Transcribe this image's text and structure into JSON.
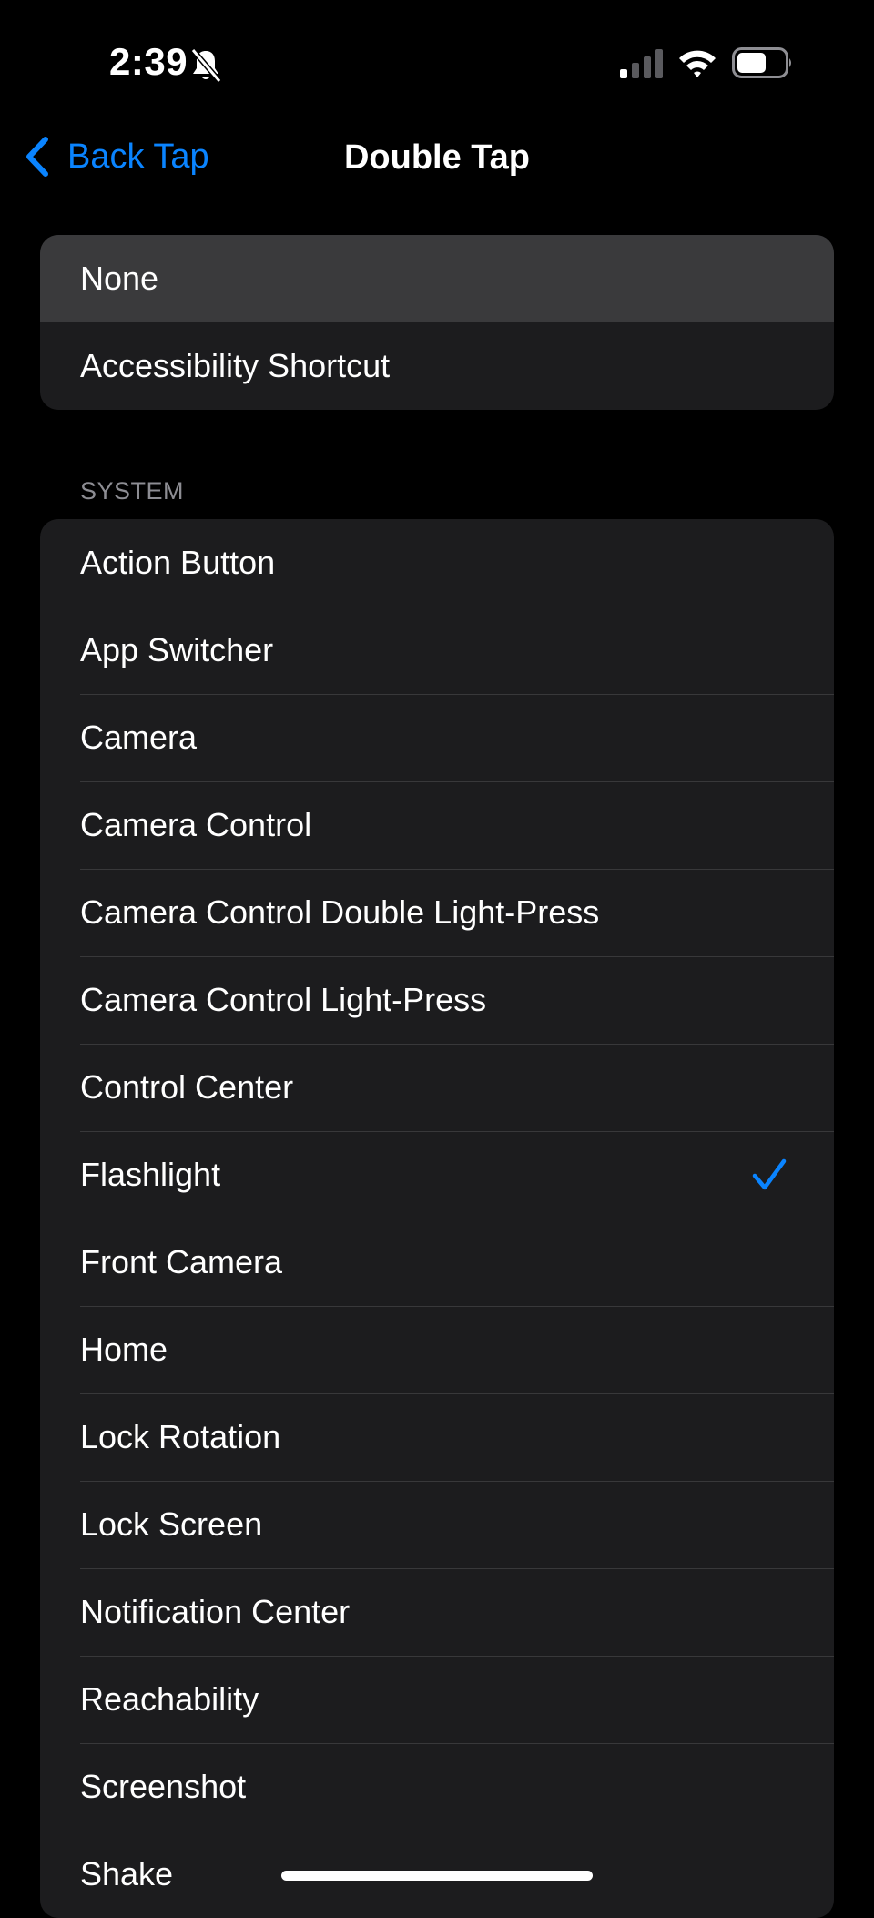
{
  "status_bar": {
    "time": "2:39",
    "icons": [
      "bell-slash-icon",
      "cellular-signal-icon",
      "wifi-icon",
      "battery-icon"
    ]
  },
  "nav": {
    "back_label": "Back Tap",
    "title": "Double Tap"
  },
  "top_group": {
    "items": [
      {
        "label": "None"
      },
      {
        "label": "Accessibility Shortcut"
      }
    ]
  },
  "system": {
    "header": "SYSTEM",
    "selected": "Flashlight",
    "items": [
      {
        "label": "Action Button"
      },
      {
        "label": "App Switcher"
      },
      {
        "label": "Camera"
      },
      {
        "label": "Camera Control"
      },
      {
        "label": "Camera Control Double Light-Press"
      },
      {
        "label": "Camera Control Light-Press"
      },
      {
        "label": "Control Center"
      },
      {
        "label": "Flashlight"
      },
      {
        "label": "Front Camera"
      },
      {
        "label": "Home"
      },
      {
        "label": "Lock Rotation"
      },
      {
        "label": "Lock Screen"
      },
      {
        "label": "Notification Center"
      },
      {
        "label": "Reachability"
      },
      {
        "label": "Screenshot"
      },
      {
        "label": "Shake"
      }
    ]
  },
  "colors": {
    "accent": "#0a84ff",
    "background": "#000000",
    "cell": "#1c1c1e",
    "highlight": "#3a3a3c",
    "separator": "#38383a",
    "secondary_text": "#8d8d93"
  }
}
